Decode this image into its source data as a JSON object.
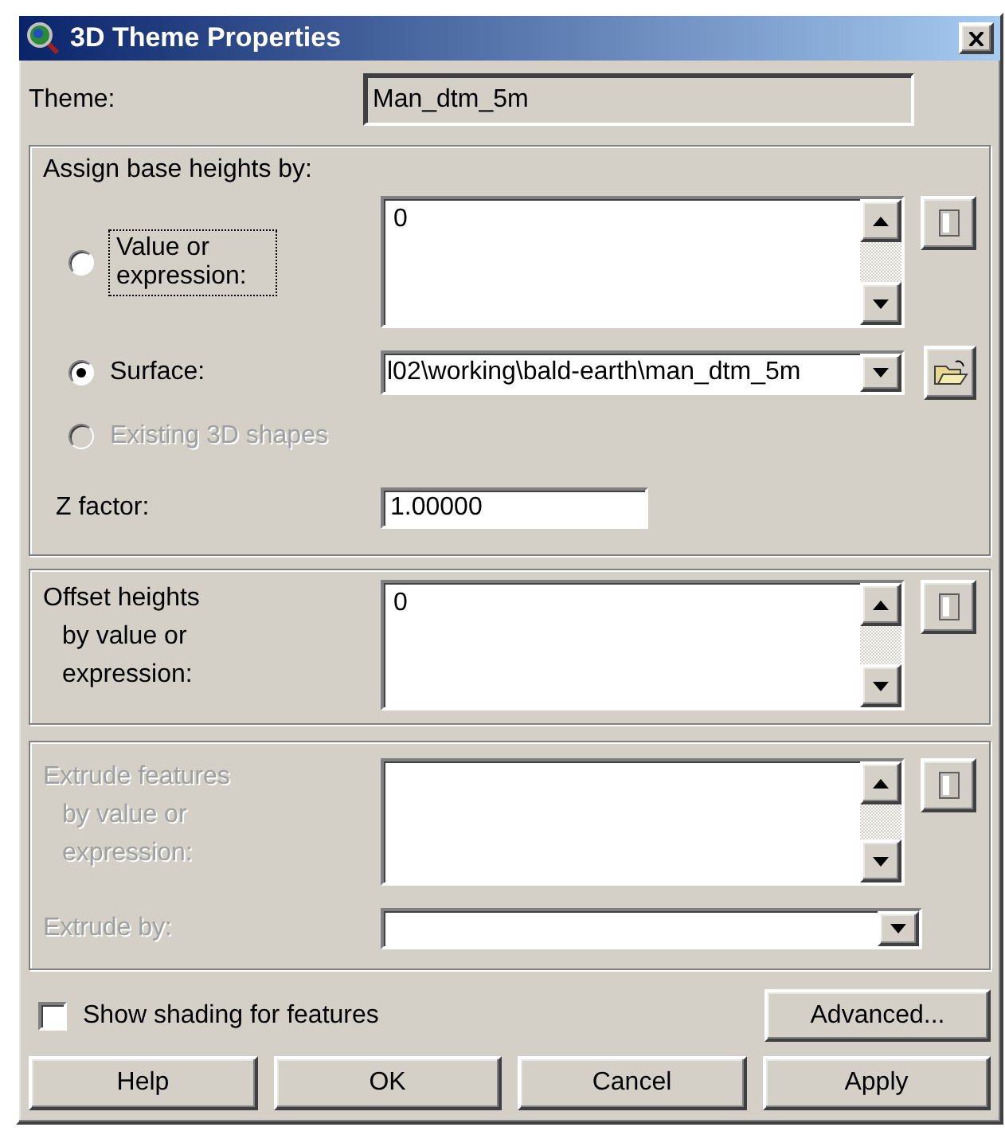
{
  "window": {
    "title": "3D Theme Properties"
  },
  "theme": {
    "label": "Theme:",
    "value": "Man_dtm_5m"
  },
  "base_heights": {
    "title": "Assign base heights by:",
    "options": [
      {
        "kind": "expression",
        "label": "Value or expression:",
        "selected": false,
        "disabled": false,
        "focused": true
      },
      {
        "kind": "surface",
        "label": "Surface:",
        "selected": true,
        "disabled": false,
        "focused": false
      },
      {
        "kind": "shapes",
        "label": "Existing 3D shapes",
        "selected": false,
        "disabled": true,
        "focused": false
      }
    ],
    "expression_value": "0",
    "surface_value": "l02\\working\\bald-earth\\man_dtm_5m",
    "z_factor": {
      "label": "Z factor:",
      "value": "1.00000"
    }
  },
  "offset": {
    "label_lines": [
      "Offset heights",
      "by value or",
      "expression:"
    ],
    "value": "0",
    "disabled": false
  },
  "extrude": {
    "label_lines": [
      "Extrude features",
      "by value or",
      "expression:"
    ],
    "by_label": "Extrude by:",
    "disabled": true
  },
  "shading": {
    "label": "Show shading for features",
    "checked": false
  },
  "advanced_button": "Advanced...",
  "buttons": [
    "Help",
    "OK",
    "Cancel",
    "Apply"
  ]
}
